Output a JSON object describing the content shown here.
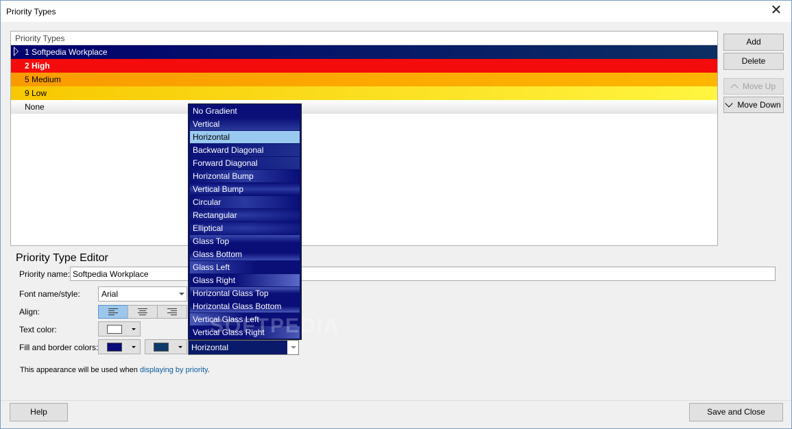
{
  "window": {
    "title": "Priority Types",
    "close_glyph": "✕"
  },
  "list": {
    "header": "Priority Types",
    "rows": [
      {
        "label": "1 Softpedia Workplace"
      },
      {
        "label": "2 High"
      },
      {
        "label": "5 Medium"
      },
      {
        "label": "9 Low"
      },
      {
        "label": "None"
      }
    ]
  },
  "side_buttons": {
    "add": "Add",
    "delete": "Delete",
    "move_up": "Move Up",
    "move_down": "Move Down"
  },
  "editor": {
    "title": "Priority Type Editor",
    "priority_name_label": "Priority name:",
    "priority_name_value": "Softpedia Workplace",
    "font_label": "Font name/style:",
    "font_value": "Arial",
    "align_label": "Align:",
    "text_color_label": "Text color:",
    "fill_border_label": "Fill and border colors:",
    "gradient_value": "Horizontal",
    "text_color": "#ffffff",
    "fill_color": "#0a0a7a",
    "border_color": "#0e3a6a"
  },
  "gradient_options": [
    "No Gradient",
    "Vertical",
    "Horizontal",
    "Backward Diagonal",
    "Forward Diagonal",
    "Horizontal Bump",
    "Vertical Bump",
    "Circular",
    "Rectangular",
    "Elliptical",
    "Glass Top",
    "Glass Bottom",
    "Glass Left",
    "Glass Right",
    "Horizontal Glass Top",
    "Horizontal Glass Bottom",
    "Vertical Glass Left",
    "Vertical Glass Right"
  ],
  "info": {
    "text": "This appearance will be used when ",
    "link": "displaying by priority",
    "suffix": "."
  },
  "footer": {
    "help": "Help",
    "save_close": "Save and Close"
  },
  "watermark": "SOFTPEDIA"
}
